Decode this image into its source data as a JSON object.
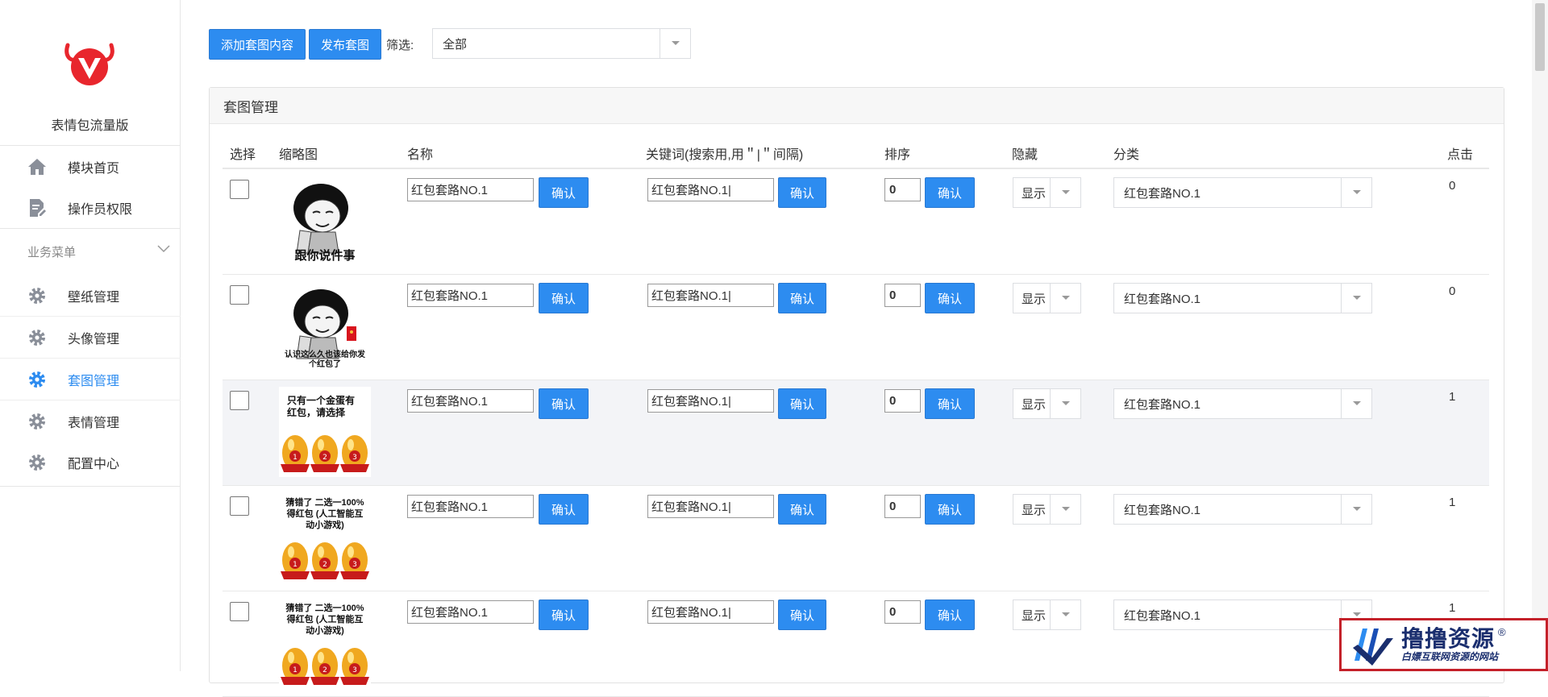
{
  "sidebar": {
    "brand": "表情包流量版",
    "top_items": [
      {
        "label": "模块首页",
        "icon": "home-icon"
      },
      {
        "label": "操作员权限",
        "icon": "document-edit-icon"
      }
    ],
    "group_title": "业务菜单",
    "sub_items": [
      {
        "label": "壁纸管理",
        "icon": "gear-icon"
      },
      {
        "label": "头像管理",
        "icon": "gear-icon"
      },
      {
        "label": "套图管理",
        "icon": "gear-icon",
        "active": true
      },
      {
        "label": "表情管理",
        "icon": "gear-icon"
      },
      {
        "label": "配置中心",
        "icon": "gear-icon"
      }
    ]
  },
  "toolbar": {
    "add_label": "添加套图内容",
    "publish_label": "发布套图",
    "filter_label": "筛选:",
    "filter_value": "全部"
  },
  "panel": {
    "title": "套图管理",
    "columns": [
      "选择",
      "缩略图",
      "名称",
      "关键词(搜索用,用＂|＂间隔)",
      "排序",
      "隐藏",
      "分类",
      "点击"
    ],
    "confirm_label": "确认",
    "rows": [
      {
        "thumb_caption": "跟你说件事",
        "name": "红包套路NO.1",
        "keyword": "红包套路NO.1|",
        "sort": "0",
        "hidden": "显示",
        "category": "红包套路NO.1",
        "clicks": "0"
      },
      {
        "thumb_caption": "认识这么久也该给你发个红包了",
        "name": "红包套路NO.1",
        "keyword": "红包套路NO.1|",
        "sort": "0",
        "hidden": "显示",
        "category": "红包套路NO.1",
        "clicks": "0"
      },
      {
        "thumb_caption": "只有一个金蛋有红包，请选择",
        "name": "红包套路NO.1",
        "keyword": "红包套路NO.1|",
        "sort": "0",
        "hidden": "显示",
        "category": "红包套路NO.1",
        "clicks": "1"
      },
      {
        "thumb_caption": "猜错了 二选一100%得红包 (人工智能互动小游戏)",
        "name": "红包套路NO.1",
        "keyword": "红包套路NO.1|",
        "sort": "0",
        "hidden": "显示",
        "category": "红包套路NO.1",
        "clicks": "1"
      },
      {
        "thumb_caption": "猜错了 二选一100%得红包 (人工智能互动小游戏)",
        "name": "红包套路NO.1",
        "keyword": "红包套路NO.1|",
        "sort": "0",
        "hidden": "显示",
        "category": "红包套路NO.1",
        "clicks": "1"
      }
    ]
  },
  "watermark": {
    "title": "撸撸资源",
    "subtitle": "白嫖互联网资源的网站",
    "mark": "®"
  },
  "colors": {
    "primary": "#2d8cf0",
    "logo_red": "#e8262d",
    "watermark_border": "#c4212a",
    "watermark_text": "#1a2e6e"
  }
}
